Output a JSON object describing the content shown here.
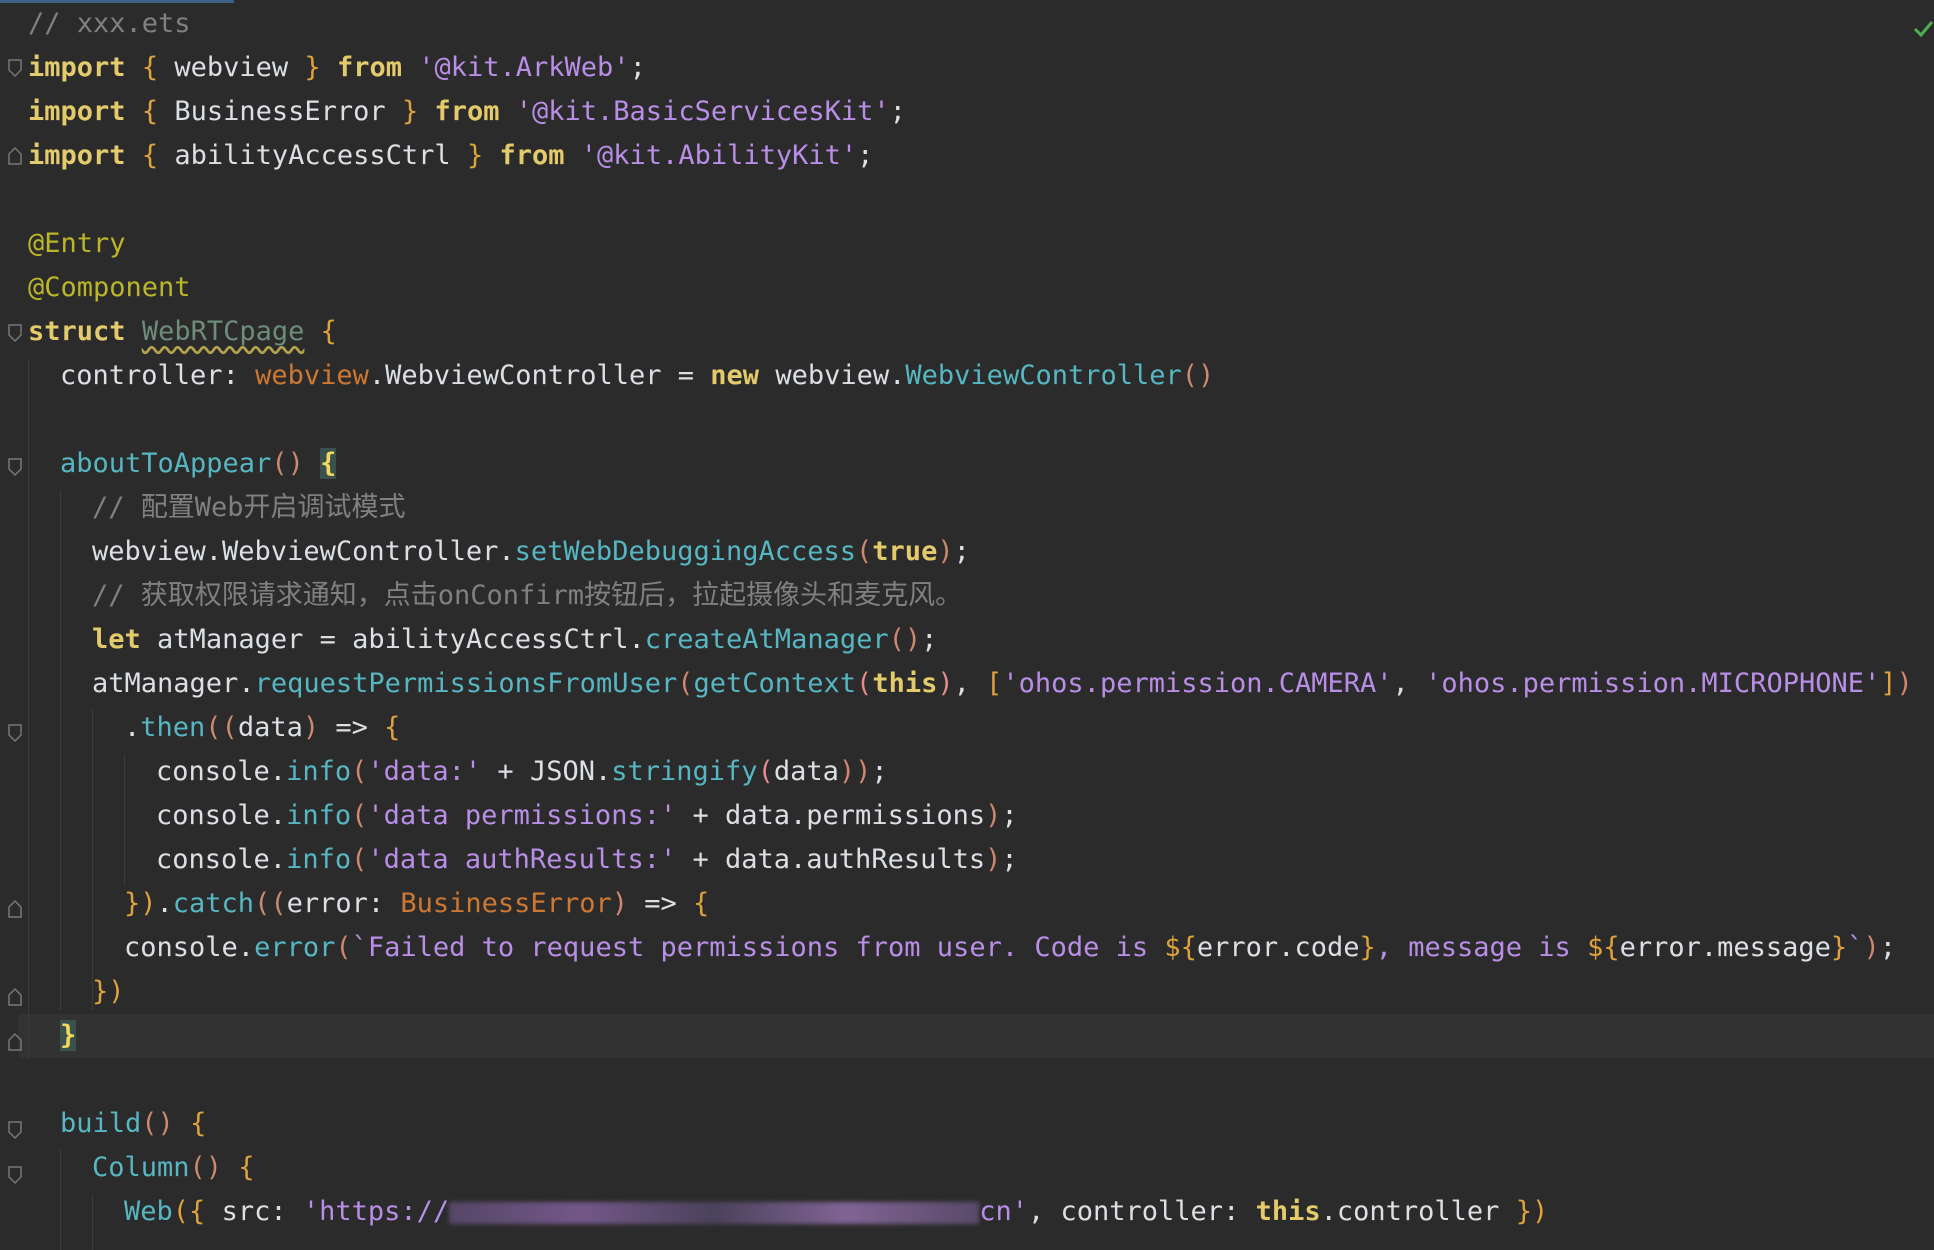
{
  "editor": {
    "language": "ArkTS",
    "accent_color": "#3d6185",
    "status_icon": "check-icon"
  },
  "lines": {
    "l1": "// xxx.ets",
    "l2": {
      "kw": "import",
      "ob": "{",
      "name": "webview",
      "cb": "}",
      "from": "from",
      "mod": "'@kit.ArkWeb'",
      "end": ";"
    },
    "l3": {
      "kw": "import",
      "ob": "{",
      "name": "BusinessError",
      "cb": "}",
      "from": "from",
      "mod": "'@kit.BasicServicesKit'",
      "end": ";"
    },
    "l4": {
      "kw": "import",
      "ob": "{",
      "name": "abilityAccessCtrl",
      "cb": "}",
      "from": "from",
      "mod": "'@kit.AbilityKit'",
      "end": ";"
    },
    "l6": "@Entry",
    "l7": "@Component",
    "l8": {
      "kw": "struct",
      "name": "WebRTCpage",
      "ob": "{"
    },
    "l9": {
      "field": "controller",
      "colon": ":",
      "ns": "webview",
      "dot": ".",
      "type": "WebviewController",
      "eq": "=",
      "new": "new",
      "ns2": "webview",
      "dot2": ".",
      "ctor": "WebviewController",
      "parens": "()"
    },
    "l11": {
      "fn": "aboutToAppear",
      "parens": "()",
      "ob": "{"
    },
    "l12": "// 配置Web开启调试模式",
    "l13": {
      "obj": "webview.WebviewController",
      "dot": ".",
      "method": "setWebDebuggingAccess",
      "op": "(",
      "arg": "true",
      "cp": ")",
      "end": ";"
    },
    "l14": "// 获取权限请求通知，点击onConfirm按钮后，拉起摄像头和麦克风。",
    "l15": {
      "kw": "let",
      "var": "atManager",
      "eq": "=",
      "obj": "abilityAccessCtrl",
      "dot": ".",
      "method": "createAtManager",
      "parens": "()",
      "end": ";"
    },
    "l16": {
      "obj": "atManager",
      "dot": ".",
      "method": "requestPermissionsFromUser",
      "op": "(",
      "fn": "getContext",
      "op2": "(",
      "this": "this",
      "cp2": ")",
      "comma": ",",
      "ob": "[",
      "p1": "'ohos.permission.CAMERA'",
      "comma2": ",",
      "p2": "'ohos.permission.MICROPHONE'",
      "cb": "]",
      "cp": ")"
    },
    "l17": {
      "dot": ".",
      "method": "then",
      "op": "((",
      "arg": "data",
      "cp": ")",
      "arrow": "=>",
      "ob": "{"
    },
    "l18": {
      "obj": "console",
      "dot": ".",
      "method": "info",
      "op": "(",
      "str": "'data:'",
      "plus": "+",
      "json": "JSON",
      "dot2": ".",
      "m2": "stringify",
      "op2": "(",
      "arg": "data",
      "cp": "))",
      "end": ";"
    },
    "l19": {
      "obj": "console",
      "dot": ".",
      "method": "info",
      "op": "(",
      "str": "'data permissions:'",
      "plus": "+",
      "expr": "data.permissions",
      "cp": ")",
      "end": ";"
    },
    "l20": {
      "obj": "console",
      "dot": ".",
      "method": "info",
      "op": "(",
      "str": "'data authResults:'",
      "plus": "+",
      "expr": "data.authResults",
      "cp": ")",
      "end": ";"
    },
    "l21": {
      "cb": "})",
      "dot": ".",
      "method": "catch",
      "op": "((",
      "arg": "error",
      "colon": ":",
      "type": "BusinessError",
      "cp": ")",
      "arrow": "=>",
      "ob": "{"
    },
    "l22": {
      "obj": "console",
      "dot": ".",
      "method": "error",
      "op": "(",
      "t1": "`Failed to request permissions from user. Code is ",
      "d1": "${",
      "e1": "error.code",
      "c1": "}",
      "t2": ", message is ",
      "d2": "${",
      "e2": "error.message",
      "c2": "}",
      "t3": "`",
      "cp": ")",
      "end": ";"
    },
    "l23": "})",
    "l24": "}",
    "l26": {
      "fn": "build",
      "parens": "()",
      "ob": "{"
    },
    "l27": {
      "fn": "Column",
      "parens": "()",
      "ob": "{"
    },
    "l28": {
      "fn": "Web",
      "op": "({",
      "key": "src",
      "colon": ":",
      "url_start": "'https://",
      "url_end": "cn'",
      "comma": ",",
      "key2": "controller",
      "colon2": ":",
      "this": "this",
      "prop": ".controller",
      "cp": "})"
    }
  }
}
